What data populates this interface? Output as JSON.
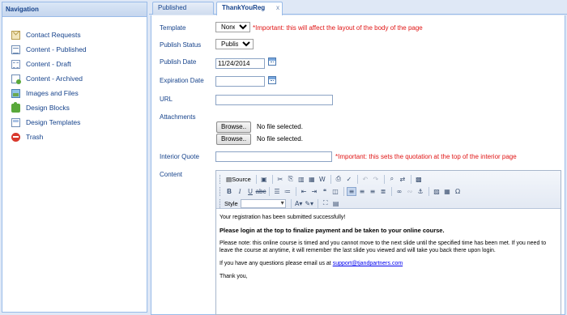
{
  "nav": {
    "title": "Navigation",
    "items": [
      {
        "label": "Contact Requests",
        "icon": "envelope-icon"
      },
      {
        "label": "Content - Published",
        "icon": "document-icon"
      },
      {
        "label": "Content - Draft",
        "icon": "draft-document-icon"
      },
      {
        "label": "Content - Archived",
        "icon": "archive-document-icon"
      },
      {
        "label": "Images and Files",
        "icon": "image-icon"
      },
      {
        "label": "Design Blocks",
        "icon": "puzzle-icon"
      },
      {
        "label": "Design Templates",
        "icon": "template-icon"
      },
      {
        "label": "Trash",
        "icon": "trash-icon"
      }
    ]
  },
  "tabs": [
    {
      "label": "Published"
    },
    {
      "label": "ThankYouReg",
      "close": "x"
    }
  ],
  "form": {
    "template": {
      "label": "Template",
      "value": "None",
      "note": "*Important: this will affect the layout of the body of the page"
    },
    "publish_status": {
      "label": "Publish Status",
      "value": "Publish"
    },
    "publish_date": {
      "label": "Publish Date",
      "value": "11/24/2014"
    },
    "expiration_date": {
      "label": "Expiration Date",
      "value": ""
    },
    "url": {
      "label": "URL",
      "value": ""
    },
    "attachments": {
      "label": "Attachments",
      "browse_label": "Browse..",
      "no_file": "No file selected."
    },
    "interior_quote": {
      "label": "Interior Quote",
      "value": "",
      "note": "*Important: this sets the quotation at the top of the interior page"
    },
    "content": {
      "label": "Content"
    }
  },
  "editor": {
    "source_label": "Source",
    "style_label": "Style",
    "body": {
      "p1": "Your registration has been submitted successfully!",
      "p2": "Please login at the top to finalize payment and be taken to your online course.",
      "p3": "Please note: this online course is timed and you cannot move to the next slide until the specified time has been met.  If you need to leave the course at anytime, it will remember the last slide you viewed and will take you back there upon login.",
      "p4_prefix": "If you have any questions please email us at ",
      "p4_link": "support@tjandpartners.com",
      "p5": "Thank you,"
    }
  }
}
